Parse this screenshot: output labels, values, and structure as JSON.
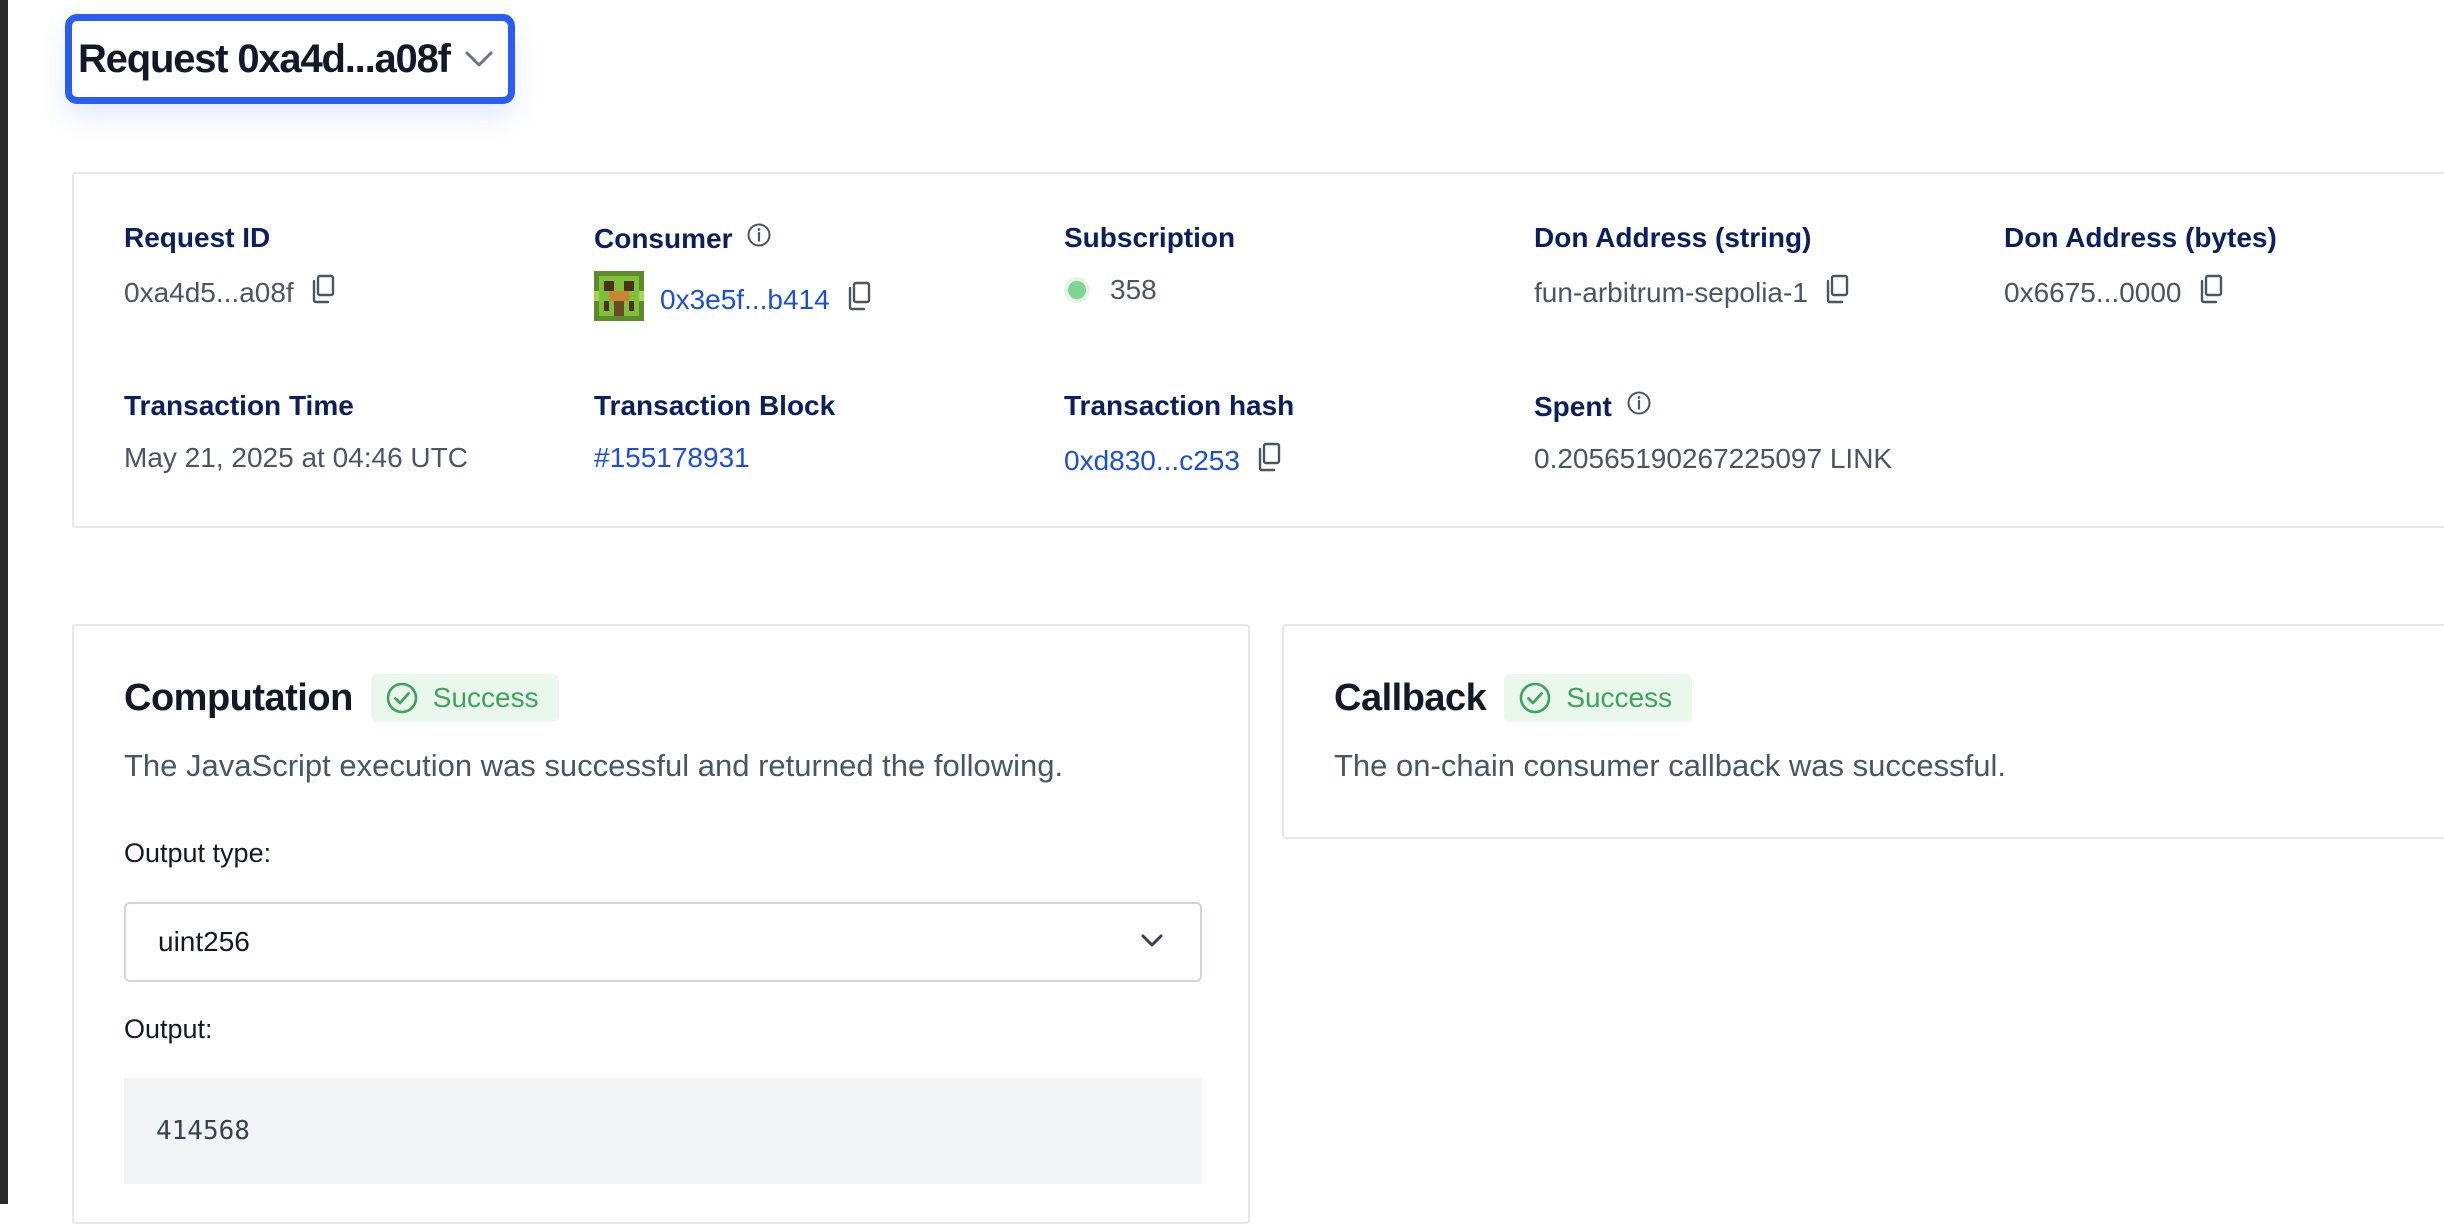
{
  "header": {
    "title": "Request 0xa4d...a08f"
  },
  "details": {
    "request_id": {
      "label": "Request ID",
      "value": "0xa4d5...a08f"
    },
    "consumer": {
      "label": "Consumer",
      "value": "0x3e5f...b414"
    },
    "subscription": {
      "label": "Subscription",
      "value": "358"
    },
    "don_string": {
      "label": "Don Address (string)",
      "value": "fun-arbitrum-sepolia-1"
    },
    "don_bytes": {
      "label": "Don Address (bytes)",
      "value": "0x6675...0000"
    },
    "tx_time": {
      "label": "Transaction Time",
      "value": "May 21, 2025 at 04:46 UTC"
    },
    "tx_block": {
      "label": "Transaction Block",
      "value": "#155178931"
    },
    "tx_hash": {
      "label": "Transaction hash",
      "value": "0xd830...c253"
    },
    "spent": {
      "label": "Spent",
      "value": "0.20565190267225097 LINK"
    }
  },
  "computation": {
    "title": "Computation",
    "status": "Success",
    "description": "The JavaScript execution was successful and returned the following.",
    "output_type_label": "Output type:",
    "output_type_value": "uint256",
    "output_label": "Output:",
    "output_value": "414568"
  },
  "callback": {
    "title": "Callback",
    "status": "Success",
    "description": "The on-chain consumer callback was successful."
  },
  "colors": {
    "accent": "#2a5ef0",
    "link": "#1c4fd8",
    "label": "#0b1f5c",
    "success_bg": "#e9f7ec",
    "success_text": "#3da35d",
    "status_dot": "#7fd494"
  },
  "icons": [
    "chevron-down-icon",
    "copy-icon",
    "info-icon",
    "check-circle-icon",
    "identicon-avatar"
  ]
}
